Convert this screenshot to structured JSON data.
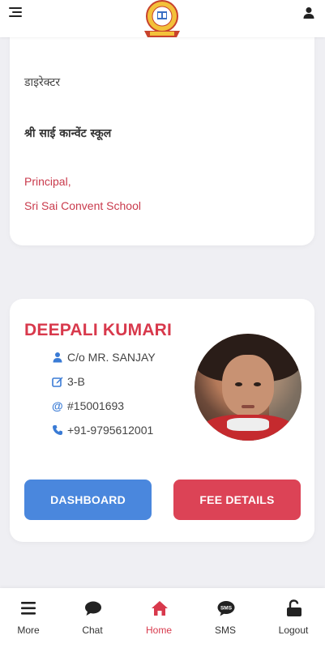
{
  "header": {
    "menu_icon": "hamburger-menu-icon",
    "logo_icon": "school-crest-logo",
    "user_icon": "user-icon"
  },
  "director_card": {
    "role": "डाइरेक्टर",
    "school_name_hindi": "श्री साई कान्वेंट स्कूल",
    "signature_line1": "Principal,",
    "signature_line2": "Sri Sai Convent School"
  },
  "student": {
    "name": "DEEPALI KUMARI",
    "parent": "C/o MR. SANJAY",
    "class": "3-B",
    "admission_no": "#15001693",
    "phone": "+91-9795612001",
    "buttons": {
      "dashboard": "DASHBOARD",
      "fee_details": "FEE DETAILS"
    }
  },
  "bottom_nav": {
    "items": [
      {
        "label": "More",
        "icon": "menu-icon"
      },
      {
        "label": "Chat",
        "icon": "chat-icon"
      },
      {
        "label": "Home",
        "icon": "home-icon",
        "active": true
      },
      {
        "label": "SMS",
        "icon": "sms-icon"
      },
      {
        "label": "Logout",
        "icon": "unlock-icon"
      }
    ]
  },
  "colors": {
    "accent_red": "#d8394c",
    "accent_blue": "#4a87dd",
    "icon_blue": "#3a7bd5",
    "background": "#efeff3"
  }
}
